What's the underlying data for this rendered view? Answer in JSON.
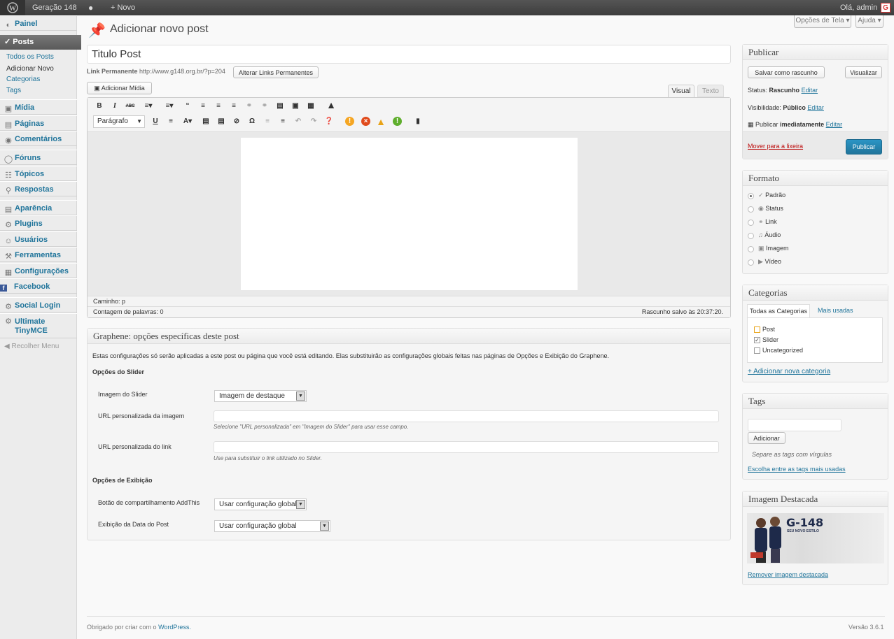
{
  "adminbar": {
    "site": "Geração 148",
    "new": "Novo",
    "greeting": "Olá, admin",
    "avatar_letter": "G"
  },
  "sidebar": {
    "painel": "Painel",
    "posts": "Posts",
    "posts_sub": [
      "Todos os Posts",
      "Adicionar Novo",
      "Categorias",
      "Tags"
    ],
    "midia": "Mídia",
    "paginas": "Páginas",
    "comentarios": "Comentários",
    "foruns": "Fóruns",
    "topicos": "Tópicos",
    "respostas": "Respostas",
    "aparencia": "Aparência",
    "plugins": "Plugins",
    "usuarios": "Usuários",
    "ferramentas": "Ferramentas",
    "configuracoes": "Configurações",
    "facebook": "Facebook",
    "social_login": "Social Login",
    "ultimate1": "Ultimate",
    "ultimate2": "TinyMCE",
    "collapse": "Recolher Menu"
  },
  "screen_options": "Opções de Tela",
  "help": "Ajuda",
  "page_title": "Adicionar novo post",
  "post": {
    "title_value": "Titulo Post",
    "permalink_label": "Link Permanente",
    "permalink_url": "http://www.g148.org.br/?p=204",
    "change_permalinks": "Alterar Links Permanentes",
    "add_media": "Adicionar Mídia",
    "tab_visual": "Visual",
    "tab_text": "Texto",
    "format_select": "Parágrafo",
    "path": "Caminho: p",
    "word_count": "Contagem de palavras: 0",
    "draft_saved": "Rascunho salvo às 20:37:20."
  },
  "graphene": {
    "title": "Graphene: opções específicas deste post",
    "intro": "Estas configurações só serão aplicadas a este post ou página que você está editando. Elas substituirão as configurações globais feitas nas páginas de Opções e Exibição do Graphene.",
    "slider_heading": "Opções do Slider",
    "slider_image_label": "Imagem do Slider",
    "slider_image_value": "Imagem de destaque",
    "url_image_label": "URL personalizada da imagem",
    "url_image_help": "Selecione \"URL personalizada\" em \"Imagem do Slider\" para usar esse campo.",
    "url_link_label": "URL personalizada do link",
    "url_link_help": "Use para substituir o link utilizado no Slider.",
    "display_heading": "Opções de Exibição",
    "addthis_label": "Botão de compartilhamento AddThis",
    "addthis_value": "Usar configuração global",
    "date_label": "Exibição da Data do Post",
    "date_value": "Usar configuração global"
  },
  "publish": {
    "title": "Publicar",
    "save_draft": "Salvar como rascunho",
    "preview": "Visualizar",
    "status_label": "Status:",
    "status_value": "Rascunho",
    "edit": "Editar",
    "visibility_label": "Visibilidade:",
    "visibility_value": "Público",
    "publish_label": "Publicar",
    "publish_value": "imediatamente",
    "trash": "Mover para a lixeira",
    "publish_button": "Publicar"
  },
  "format": {
    "title": "Formato",
    "options": [
      "Padrão",
      "Status",
      "Link",
      "Áudio",
      "Imagem",
      "Vídeo"
    ],
    "selected": "Padrão"
  },
  "categories": {
    "title": "Categorias",
    "tab_all": "Todas as Categorias",
    "tab_popular": "Mais usadas",
    "items": [
      {
        "label": "Post",
        "checked": false
      },
      {
        "label": "Slider",
        "checked": true
      },
      {
        "label": "Uncategorized",
        "checked": false
      }
    ],
    "add_new": "+ Adicionar nova categoria"
  },
  "tags": {
    "title": "Tags",
    "add": "Adicionar",
    "hint": "Separe as tags com vírgulas",
    "choose": "Escolha entre as tags mais usadas"
  },
  "featured": {
    "title": "Imagem Destacada",
    "logo": "G-148",
    "tagline": "SEU NOVO ESTILO",
    "remove": "Remover imagem destacada"
  },
  "footer": {
    "thanks": "Obrigado por criar com o",
    "wp": "WordPress.",
    "version": "Versão 3.6.1"
  }
}
